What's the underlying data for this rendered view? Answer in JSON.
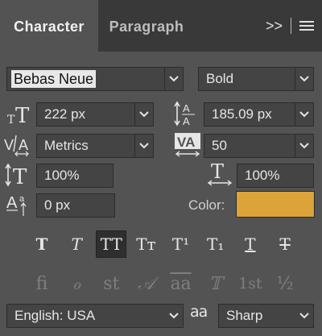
{
  "tabs": {
    "active": "Character",
    "inactive": "Paragraph"
  },
  "panel_controls": {
    "expand": ">>",
    "menu_icon": "menu-icon"
  },
  "font": {
    "family": "Bebas Neue",
    "style": "Bold"
  },
  "size": {
    "font_size": "222 px",
    "leading": "185.09 px"
  },
  "kerning": {
    "value": "Metrics",
    "tracking": "50"
  },
  "scale": {
    "vertical": "100%",
    "horizontal": "100%"
  },
  "baseline": {
    "shift": "0 px"
  },
  "color": {
    "label": "Color:",
    "value": "#dba338"
  },
  "style_buttons": [
    {
      "name": "faux-bold-button",
      "glyph": "T"
    },
    {
      "name": "faux-italic-button",
      "glyph": "T"
    },
    {
      "name": "all-caps-button",
      "glyph": "TT",
      "active": true
    },
    {
      "name": "small-caps-button",
      "glyph": "Tт"
    },
    {
      "name": "superscript-button",
      "glyph": "T¹"
    },
    {
      "name": "subscript-button",
      "glyph": "T₁"
    },
    {
      "name": "underline-button",
      "glyph": "T"
    },
    {
      "name": "strikethrough-button",
      "glyph": "T"
    }
  ],
  "opentype_buttons": [
    {
      "name": "ligatures-button",
      "glyph": "ﬁ"
    },
    {
      "name": "discretionary-ligatures-button",
      "glyph": "ℴ"
    },
    {
      "name": "contextual-alternates-button",
      "glyph": "st"
    },
    {
      "name": "swash-button",
      "glyph": "𝒜"
    },
    {
      "name": "stylistic-alternates-button",
      "glyph": "aa"
    },
    {
      "name": "titling-alternates-button",
      "glyph": "𝕋"
    },
    {
      "name": "ordinals-button",
      "glyph": "1st"
    },
    {
      "name": "fractions-button",
      "glyph": "½"
    }
  ],
  "language": "English: USA",
  "antialias": {
    "icon_label": "aa",
    "value": "Sharp"
  }
}
